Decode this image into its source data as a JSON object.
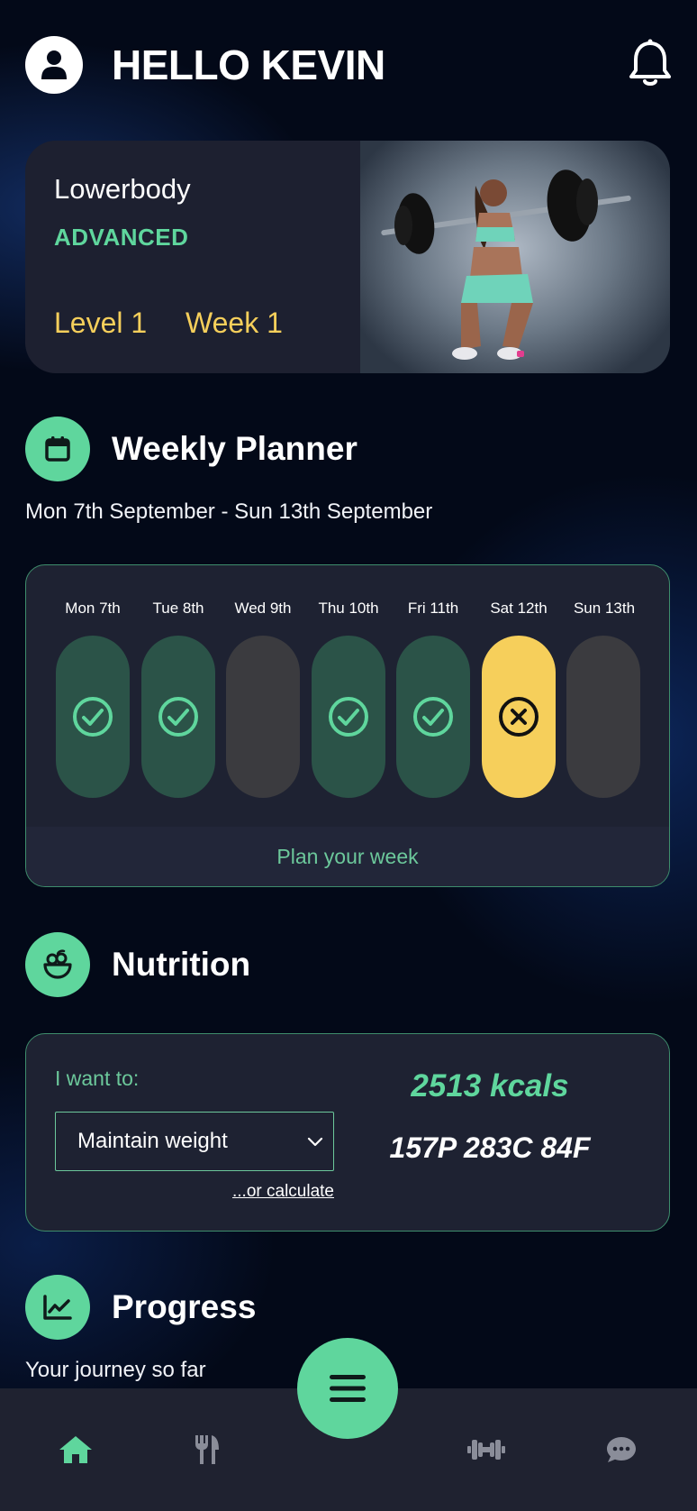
{
  "header": {
    "greeting": "HELLO KEVIN",
    "avatar_icon": "user-icon",
    "notification_icon": "bell-icon"
  },
  "program": {
    "name": "Lowerbody",
    "difficulty": "ADVANCED",
    "level": "Level 1",
    "week": "Week 1",
    "image_icon": "barbell-squat-photo"
  },
  "planner": {
    "icon": "calendar-icon",
    "title": "Weekly Planner",
    "date_range": "Mon 7th September - Sun 13th September",
    "days": [
      {
        "label": "Mon 7th",
        "status": "done"
      },
      {
        "label": "Tue 8th",
        "status": "done"
      },
      {
        "label": "Wed 9th",
        "status": "empty"
      },
      {
        "label": "Thu 10th",
        "status": "done"
      },
      {
        "label": "Fri 11th",
        "status": "done"
      },
      {
        "label": "Sat 12th",
        "status": "missed"
      },
      {
        "label": "Sun 13th",
        "status": "empty"
      }
    ],
    "footer_action": "Plan your week"
  },
  "nutrition": {
    "icon": "salad-bowl-icon",
    "title": "Nutrition",
    "goal_label": "I want to:",
    "goal_selected": "Maintain weight",
    "calculate_link": "...or calculate",
    "kcals": "2513 kcals",
    "macros": "157P 283C 84F"
  },
  "progress": {
    "icon": "chart-line-icon",
    "title": "Progress",
    "subtitle": "Your journey so far"
  },
  "nav": {
    "items": [
      "home-icon",
      "utensils-icon",
      "menu-icon",
      "dumbbell-icon",
      "chat-icon"
    ],
    "active": "home-icon"
  },
  "colors": {
    "accent": "#5fd69d",
    "highlight": "#f6cf5b",
    "background": "#030918",
    "card": "#1e2232"
  }
}
